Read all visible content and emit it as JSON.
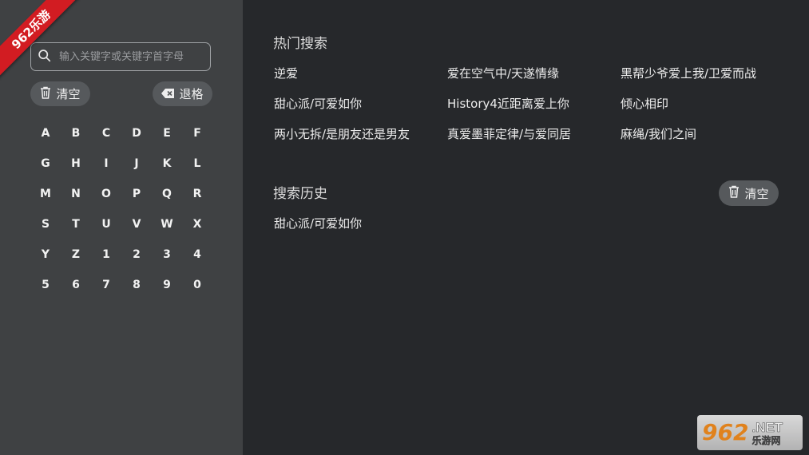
{
  "ribbon": {
    "text": "962乐游"
  },
  "search": {
    "placeholder": "输入关键字或关键字首字母"
  },
  "buttons": {
    "clear": "清空",
    "backspace": "退格",
    "history_clear": "清空"
  },
  "keyboard": {
    "keys": [
      "A",
      "B",
      "C",
      "D",
      "E",
      "F",
      "G",
      "H",
      "I",
      "J",
      "K",
      "L",
      "M",
      "N",
      "O",
      "P",
      "Q",
      "R",
      "S",
      "T",
      "U",
      "V",
      "W",
      "X",
      "Y",
      "Z",
      "1",
      "2",
      "3",
      "4",
      "5",
      "6",
      "7",
      "8",
      "9",
      "0"
    ]
  },
  "hot": {
    "title": "热门搜索",
    "items": [
      "逆爱",
      "爱在空气中/天遂情缘",
      "黑帮少爷爱上我/卫爱而战",
      "甜心派/可爱如你",
      "History4近距离爱上你",
      "倾心相印",
      "两小无拆/是朋友还是男友",
      "真爱墨菲定律/与爱同居",
      "麻绳/我们之间"
    ]
  },
  "history": {
    "title": "搜索历史",
    "items": [
      "甜心派/可爱如你"
    ]
  },
  "watermark": {
    "number": "962",
    "net": ".NET",
    "cn": "乐游网"
  },
  "colors": {
    "left_panel": "#3f4143",
    "right_panel": "#26282b",
    "ribbon": "#d21c22",
    "pill": "#56595c"
  }
}
